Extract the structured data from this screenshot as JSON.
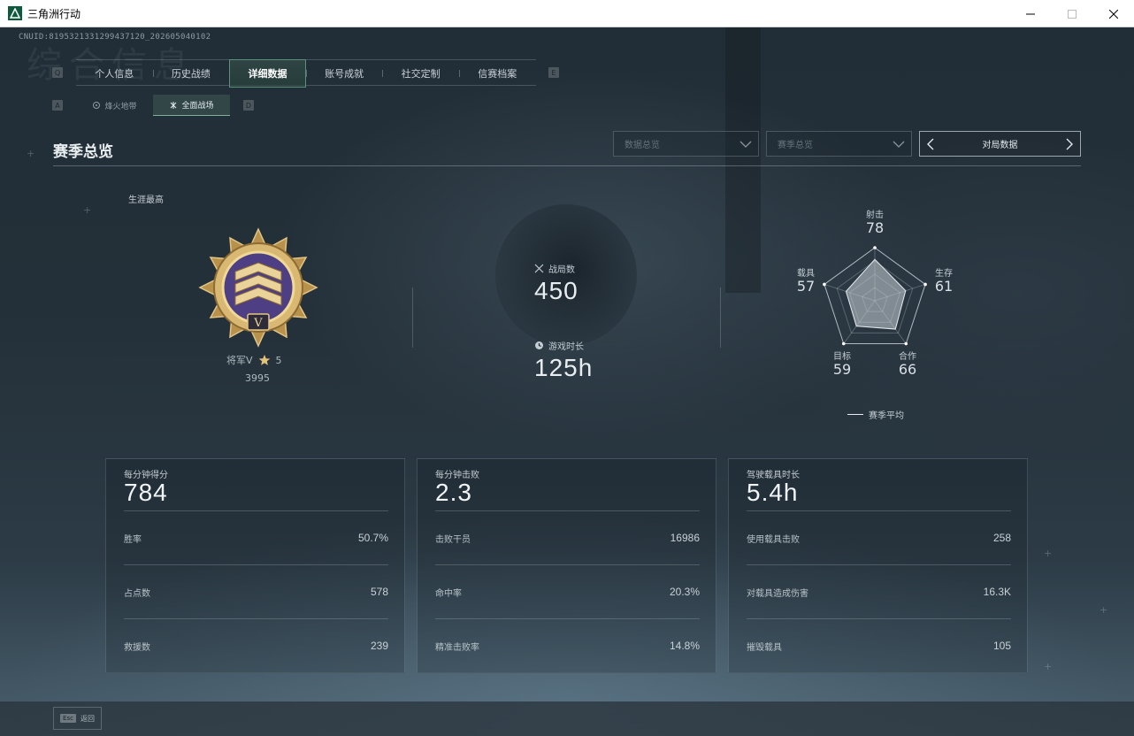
{
  "window": {
    "title": "三角洲行动"
  },
  "uid": "CNUID:8195321331299437120_202605040102",
  "header": {
    "ghost_title": "综合信息",
    "key_left": "Q",
    "key_right": "E",
    "tabs": [
      {
        "label": "个人信息"
      },
      {
        "label": "历史战绩"
      },
      {
        "label": "详细数据",
        "active": true
      },
      {
        "label": "账号成就"
      },
      {
        "label": "社交定制"
      },
      {
        "label": "信赛档案"
      }
    ],
    "sub_key_left": "A",
    "sub_key_right": "D",
    "sub_tabs": [
      {
        "label": "烽火地带"
      },
      {
        "label": "全面战场",
        "active": true
      }
    ]
  },
  "section": {
    "title": "赛季总览",
    "dropdown1": "数据总览",
    "dropdown2": "赛季总览",
    "nav_label": "对局数据"
  },
  "career": {
    "label": "生涯最高",
    "rank_name": "将军V",
    "stars": "5",
    "score": "3995",
    "badge_numeral": "V"
  },
  "stats": {
    "matches_label": "战局数",
    "matches_value": "450",
    "playtime_label": "游戏时长",
    "playtime_value": "125h"
  },
  "radar": {
    "axes": [
      {
        "label": "射击",
        "value": 78
      },
      {
        "label": "生存",
        "value": 61
      },
      {
        "label": "合作",
        "value": 66
      },
      {
        "label": "目标",
        "value": 59
      },
      {
        "label": "载具",
        "value": 57
      }
    ],
    "legend": "赛季平均"
  },
  "cards": [
    {
      "title": "每分钟得分",
      "value": "784",
      "rows": [
        {
          "label": "胜率",
          "value": "50.7%"
        },
        {
          "label": "占点数",
          "value": "578"
        },
        {
          "label": "救援数",
          "value": "239"
        }
      ]
    },
    {
      "title": "每分钟击败",
      "value": "2.3",
      "rows": [
        {
          "label": "击败干员",
          "value": "16986"
        },
        {
          "label": "命中率",
          "value": "20.3%"
        },
        {
          "label": "精准击败率",
          "value": "14.8%"
        }
      ]
    },
    {
      "title": "驾驶载具时长",
      "value": "5.4h",
      "rows": [
        {
          "label": "使用载具击败",
          "value": "258"
        },
        {
          "label": "对载具造成伤害",
          "value": "16.3K"
        },
        {
          "label": "摧毁载具",
          "value": "105"
        }
      ]
    }
  ],
  "footer": {
    "esc_key": "Esc",
    "esc_label": "返回"
  },
  "colors": {
    "accent": "#5c8f7a",
    "badge_gold": "#c9a35a",
    "badge_purple": "#5b4a8e"
  }
}
